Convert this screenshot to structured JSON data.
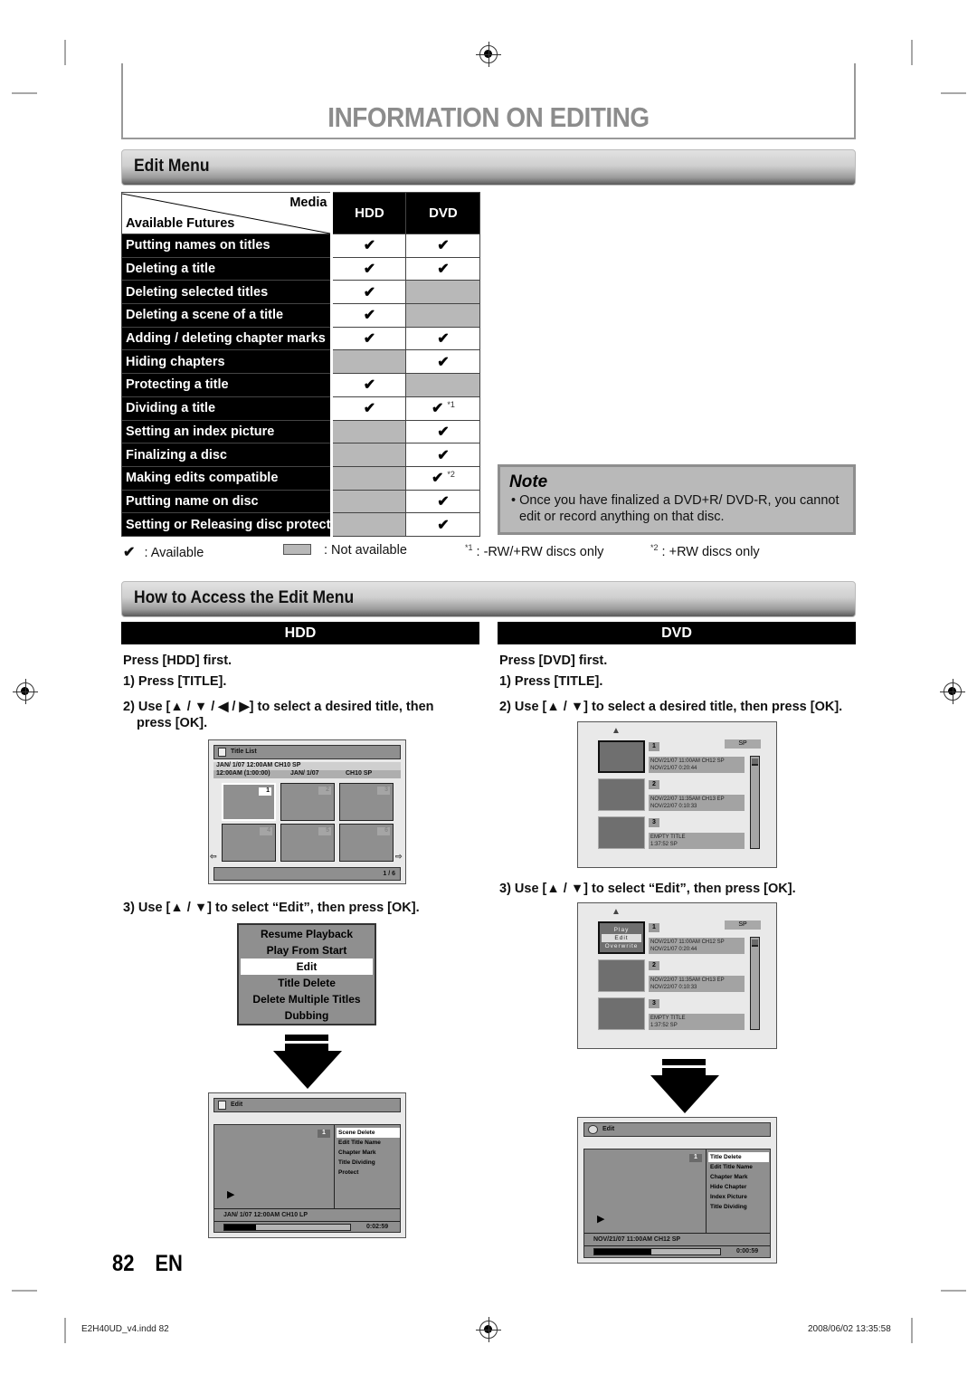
{
  "page": {
    "title": "INFORMATION ON EDITING",
    "page_number": "82",
    "language": "EN",
    "footer_left": "E2H40UD_v4.indd   82",
    "footer_right": "2008/06/02   13:35:58"
  },
  "edit_menu": {
    "heading": "Edit Menu",
    "table": {
      "corner_top": "Media",
      "corner_bottom": "Available Futures",
      "columns": [
        "HDD",
        "DVD"
      ],
      "rows": [
        {
          "feature": "Putting names on titles",
          "hdd": "✔",
          "dvd": "✔"
        },
        {
          "feature": "Deleting a title",
          "hdd": "✔",
          "dvd": "✔"
        },
        {
          "feature": "Deleting selected titles",
          "hdd": "✔",
          "dvd": null
        },
        {
          "feature": "Deleting a scene of a title",
          "hdd": "✔",
          "dvd": null
        },
        {
          "feature": "Adding / deleting chapter marks",
          "hdd": "✔",
          "dvd": "✔"
        },
        {
          "feature": "Hiding chapters",
          "hdd": null,
          "dvd": "✔"
        },
        {
          "feature": "Protecting a title",
          "hdd": "✔",
          "dvd": null
        },
        {
          "feature": "Dividing a title",
          "hdd": "✔",
          "dvd": "✔",
          "dvd_note": "*1"
        },
        {
          "feature": "Setting an index picture",
          "hdd": null,
          "dvd": "✔"
        },
        {
          "feature": "Finalizing a disc",
          "hdd": null,
          "dvd": "✔"
        },
        {
          "feature": "Making edits compatible",
          "hdd": null,
          "dvd": "✔",
          "dvd_note": "*2"
        },
        {
          "feature": "Putting name on disc",
          "hdd": null,
          "dvd": "✔"
        },
        {
          "feature": "Setting or Releasing disc protect",
          "hdd": null,
          "dvd": "✔"
        }
      ]
    },
    "legend": {
      "available_symbol": "✔",
      "available": ": Available",
      "not_available": ": Not available",
      "note1_mark": "*1",
      "note1": ": -RW/+RW discs only",
      "note2_mark": "*2",
      "note2": ": +RW discs only"
    },
    "note": {
      "title": "Note",
      "text": "• Once you have finalized a DVD+R/ DVD-R, you cannot edit or record anything on that disc."
    }
  },
  "access": {
    "heading": "How to Access the Edit Menu",
    "hdd": {
      "label": "HDD",
      "press_first": "Press [HDD] first.",
      "step1": "1) Press [TITLE].",
      "step2": "2) Use [▲ / ▼ / ◀ / ▶] to select a desired title, then press [OK].",
      "step3": "3) Use [▲ / ▼] to select “Edit”, then press [OK].",
      "title_list": {
        "header": "Title List",
        "info1": "JAN/ 1/07 12:00AM  CH10  SP",
        "info2_a": "12:00AM (1:00:00)",
        "info2_b": "JAN/  1/07",
        "info2_c": "CH10   SP",
        "thumbs": [
          "1",
          "2",
          "3",
          "4",
          "5",
          "6"
        ],
        "page": "1 / 6"
      },
      "popup_menu": [
        "Resume Playback",
        "Play From Start",
        "Edit",
        "Title Delete",
        "Delete Multiple Titles",
        "Dubbing"
      ],
      "popup_selected": "Edit",
      "edit_screen": {
        "header": "Edit",
        "title_no": "1",
        "options": [
          "Scene Delete",
          "Edit Title Name",
          "Chapter Mark",
          "Title Dividing",
          "Protect"
        ],
        "selected": "Scene Delete",
        "info": "JAN/ 1/07 12:00AM CH10   LP",
        "progress": 0.25,
        "time": "0:02:59"
      }
    },
    "dvd": {
      "label": "DVD",
      "press_first": "Press [DVD] first.",
      "step1": "1) Press [TITLE].",
      "step2": "2) Use [▲ / ▼] to select a desired title, then press [OK].",
      "step3": "3) Use [▲ / ▼] to select “Edit”, then press [OK].",
      "title_list": {
        "mode": "SP",
        "items": [
          {
            "no": "1",
            "line1": "NOV/21/07   11:00AM CH12  SP",
            "line2": "NOV/21/07     0:20:44"
          },
          {
            "no": "2",
            "line1": "NOV/22/07   11:35AM CH13  EP",
            "line2": "NOV/22/07     0:10:33"
          },
          {
            "no": "3",
            "line1": "EMPTY TITLE",
            "line2": "1:37:52  SP"
          }
        ],
        "popup": [
          "Play",
          "Edit",
          "Overwrite"
        ],
        "popup_selected": "Edit"
      },
      "edit_screen": {
        "header": "Edit",
        "title_no": "1",
        "options": [
          "Title Delete",
          "Edit Title Name",
          "Chapter Mark",
          "Hide Chapter",
          "Index Picture",
          "Title Dividing"
        ],
        "selected": "Title Delete",
        "info": "NOV/21/07 11:00AM CH12 SP",
        "progress": 0.45,
        "time": "0:00:59"
      }
    }
  }
}
